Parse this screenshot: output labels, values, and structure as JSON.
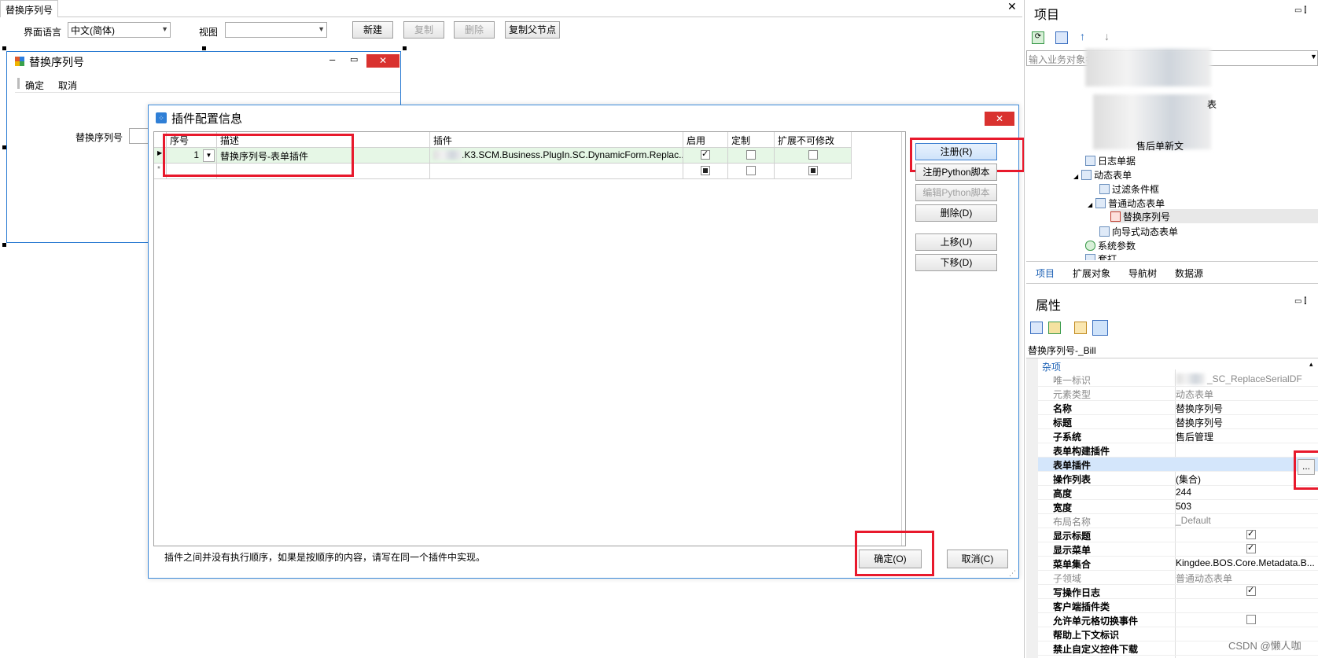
{
  "designer": {
    "tab_title": "替换序列号",
    "ui_language_label": "界面语言",
    "ui_language_value": "中文(简体)",
    "view_label": "视图",
    "view_value": "",
    "buttons": {
      "new": "新建",
      "copy": "复制",
      "delete": "删除",
      "copy_parent": "复制父节点"
    },
    "form": {
      "title": "替换序列号",
      "menu_ok": "确定",
      "menu_cancel": "取消",
      "field_label": "替换序列号"
    }
  },
  "dialog": {
    "title": "插件配置信息",
    "columns": [
      "序号",
      "描述",
      "插件",
      "启用",
      "定制",
      "扩展不可修改"
    ],
    "rows": [
      {
        "seq": "1",
        "desc": "替换序列号-表单插件",
        "plugin": ".K3.SCM.Business.PlugIn.SC.DynamicForm.Replac...",
        "enabled": true,
        "custom": false,
        "locked": false
      }
    ],
    "new_row_marker": "*",
    "buttons": {
      "register": "注册(R)",
      "register_python": "注册Python脚本",
      "edit_python": "编辑Python脚本",
      "delete": "删除(D)",
      "up": "上移(U)",
      "down": "下移(D)",
      "ok": "确定(O)",
      "cancel": "取消(C)"
    },
    "note": "插件之间并没有执行顺序，如果是按顺序的内容，请写在同一个插件中实现。"
  },
  "project_panel": {
    "title": "项目",
    "search_placeholder": "输入业务对象名称",
    "tree": [
      {
        "label": "表",
        "level": 0
      },
      {
        "label": "售后单新文",
        "level": 0
      },
      {
        "label": "日志单据",
        "level": 1
      },
      {
        "label": "动态表单",
        "level": 1
      },
      {
        "label": "过滤条件框",
        "level": 2
      },
      {
        "label": "普通动态表单",
        "level": 2
      },
      {
        "label": "替换序列号",
        "level": 3
      },
      {
        "label": "向导式动态表单",
        "level": 2
      },
      {
        "label": "系统参数",
        "level": 1
      },
      {
        "label": "套打",
        "level": 1
      }
    ],
    "tabs": [
      "项目",
      "扩展对象",
      "导航树",
      "数据源"
    ]
  },
  "property_panel": {
    "title": "属性",
    "object": "替换序列号-_Bill",
    "category": "杂项",
    "props": [
      {
        "k": "唯一标识",
        "v": "_SC_ReplaceSerialDF",
        "gray": true
      },
      {
        "k": "元素类型",
        "v": "动态表单",
        "gray": true
      },
      {
        "k": "名称",
        "v": "替换序列号"
      },
      {
        "k": "标题",
        "v": "替换序列号"
      },
      {
        "k": "子系统",
        "v": "售后管理"
      },
      {
        "k": "表单构建插件",
        "v": ""
      },
      {
        "k": "表单插件",
        "v": ""
      },
      {
        "k": "操作列表",
        "v": "(集合)"
      },
      {
        "k": "高度",
        "v": "244"
      },
      {
        "k": "宽度",
        "v": "503"
      },
      {
        "k": "布局名称",
        "v": "_Default",
        "gray": true
      },
      {
        "k": "显示标题",
        "v": "",
        "check": true
      },
      {
        "k": "显示菜单",
        "v": "",
        "check": true
      },
      {
        "k": "菜单集合",
        "v": "Kingdee.BOS.Core.Metadata.B..."
      },
      {
        "k": "子领域",
        "v": "普通动态表单",
        "gray": true
      },
      {
        "k": "写操作日志",
        "v": "",
        "check": true
      },
      {
        "k": "客户端插件类",
        "v": ""
      },
      {
        "k": "允许单元格切换事件",
        "v": "",
        "check": false
      },
      {
        "k": "帮助上下文标识",
        "v": ""
      },
      {
        "k": "禁止自定义控件下载",
        "v": ""
      }
    ],
    "ellipsis": "..."
  },
  "watermark": "CSDN @懒人咖"
}
